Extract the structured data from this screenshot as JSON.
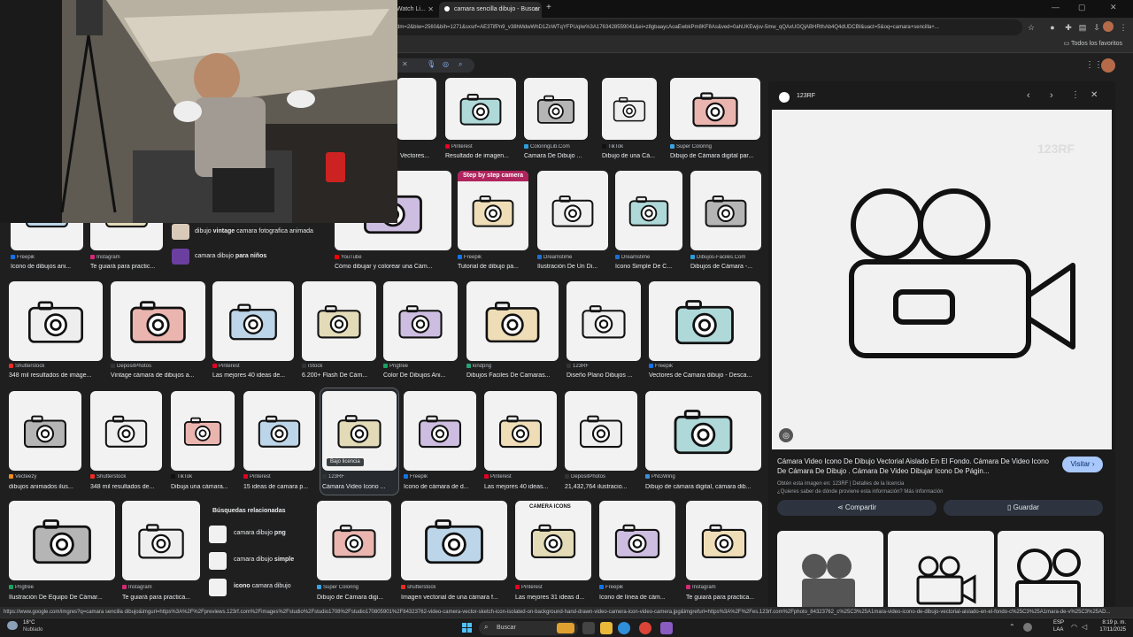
{
  "tabs": [
    {
      "label": "Watch Li..."
    },
    {
      "label": "camara sencilla dibujo - Buscar"
    }
  ],
  "address": {
    "url": "dm=2&biw=2560&bih=1271&sxsrf=AE3TifPn9_v38hMdwWhD1ZnWTqYFPUqIw%3A1763428559041&ei=z8gbaaycAoaEwbkPm8KF8As&ved=0ahUKEwjsv-5mw_qQAxUGQjABHRthAb4Q4dUDCBI&uact=5&oq=camara+sencilla+..."
  },
  "bookmarks": {
    "all_label": "Todos los favoritos"
  },
  "related": {
    "title": "Búsquedas relacionadas",
    "items": [
      {
        "prefix": "camara dibujo ",
        "bold": "png"
      },
      {
        "prefix": "camara dibujo ",
        "bold": "simple"
      },
      {
        "prefix": "",
        "bold": "icono",
        "suffix": " camara dibujo"
      }
    ]
  },
  "suggestions": [
    {
      "prefix": "dibujo ",
      "bold": "vintage",
      "suffix": " camara fotografica animada"
    },
    {
      "prefix": "camara dibujo ",
      "bold": "para niños"
    }
  ],
  "row1": [
    {
      "src": "Pinterest",
      "cap": "Resultado de imagen..."
    },
    {
      "src": "ColoringLib.Com",
      "cap": "Camara De Dibujo ..."
    },
    {
      "src": "TikTok",
      "cap": "Dibujo de una Cá..."
    },
    {
      "src": "Super Coloring",
      "cap": "Dibujo de Cámara digital par..."
    }
  ],
  "row1_partial": {
    "cap": "Vectores..."
  },
  "row2": [
    {
      "src": "Freepik",
      "cap": "Icono de dibujos ani..."
    },
    {
      "src": "Instagram",
      "cap": "Te guiará para practic..."
    },
    {
      "src": "YouTube",
      "cap": "Cómo dibujar y colorear una Cám..."
    },
    {
      "src": "Freepik",
      "cap": "Tutorial de dibujo pa..."
    },
    {
      "src": "Dreamstime",
      "cap": "Ilustración De Un Di..."
    },
    {
      "src": "Dreamstime",
      "cap": "Icono Simple De C..."
    },
    {
      "src": "Dibujos-Faciles.Com",
      "cap": "Dibujos de Cámara -..."
    }
  ],
  "stepbanner": "Step by step camera",
  "row3": [
    {
      "src": "Shutterstock",
      "cap": "348 mil resultados de imáge..."
    },
    {
      "src": "DepositPhotos",
      "cap": "Vintage cámara de dibujos a..."
    },
    {
      "src": "Pinterest",
      "cap": "Las mejores 40 ideas de..."
    },
    {
      "src": "iStock",
      "cap": "6.200+ Flash De Cám..."
    },
    {
      "src": "Pngtree",
      "cap": "Color De Dibujos Ani..."
    },
    {
      "src": "kindpng",
      "cap": "Dibujos Faciles De Camaras..."
    },
    {
      "src": "123RF",
      "cap": "Diseño Plano Dibujos ..."
    },
    {
      "src": "Freepik",
      "cap": "Vectores de Camara dibujo - Desca..."
    }
  ],
  "row4": [
    {
      "src": "Vecteezy",
      "cap": "dibujos animados ilus..."
    },
    {
      "src": "Shutterstock",
      "cap": "348 mil resultados de..."
    },
    {
      "src": "TikTok",
      "cap": "Dibuja una cámara..."
    },
    {
      "src": "Pinterest",
      "cap": "15 ideas de camara p..."
    },
    {
      "src": "123RF",
      "cap": "Cámara Video Icono ..."
    },
    {
      "src": "Freepik",
      "cap": "Icono de cámara de d..."
    },
    {
      "src": "Pinterest",
      "cap": "Las mejores 40 ideas..."
    },
    {
      "src": "DepositPhotos",
      "cap": "21,432,764 ilustracio..."
    },
    {
      "src": "PNGWing",
      "cap": "Dibujo de cámara digital, cámara dib..."
    }
  ],
  "license_badge": "Bajo licencia",
  "row5": [
    {
      "src": "Pngtree",
      "cap": "Ilustración De Equipo De Cámar..."
    },
    {
      "src": "Instagram",
      "cap": "Te guiará para practica..."
    },
    {
      "src": "Super Coloring",
      "cap": "Dibujo de Cámara digi..."
    },
    {
      "src": "shutterstock",
      "cap": "Imagen vectorial de una cámara f..."
    },
    {
      "src": "Pinterest",
      "cap": "Las mejores 31 ideas d..."
    },
    {
      "src": "Freepik",
      "cap": "Icono de línea de cám..."
    },
    {
      "src": "Instagram",
      "cap": "Te guiará para practica..."
    }
  ],
  "camera_icons_label": "CAMERA ICONS",
  "panel": {
    "source": "123RF",
    "title": "Cámara Video Icono De Dibujo Vectorial Aislado En El Fondo. Cámara De Video Icono De Cámara De Dibujo . Cámara De Video Dibujar Icono De Págin...",
    "image_from": "Obtén esta imagen en: 123RF | Detalles de la licencia",
    "copyright": "¿Quieres saber de dónde proviene esta información? Más información",
    "visit_label": "Visitar",
    "share_label": "Compartir",
    "save_label": "Guardar",
    "watermark": "123RF"
  },
  "statusbar": {
    "url": "https://www.google.com/imgres?q=camara sencilla dibujo&imgurl=https%3A%2F%2Fpreviews.123rf.com%2Fimages%2Fstudio%2Fstudio1708%2Fstudio170805901%2F84323762-video-camera-vector-sketch-icon-isolated-on-background-hand-drawn-video-camera-icon-video-camera.jpg&imgrefurl=https%3A%2F%2Fes.123rf.com%2Fphoto_84323762_c%25C3%25A1mara-video-icono-de-dibujo-vectorial-aislado-en-el-fondo-c%25C3%25A1mara-de-v%25C3%25AD..."
  },
  "taskbar": {
    "weather_temp": "18°C",
    "weather_desc": "Nublado",
    "search_placeholder": "Buscar",
    "lang_top": "ESP",
    "lang_bottom": "LAA",
    "time": "8:19 p. m.",
    "date": "17/11/2025"
  },
  "colors": {
    "accent": "#8ab4f8",
    "visit_btn": "#a8c7fa",
    "bg": "#1f1f1f"
  }
}
